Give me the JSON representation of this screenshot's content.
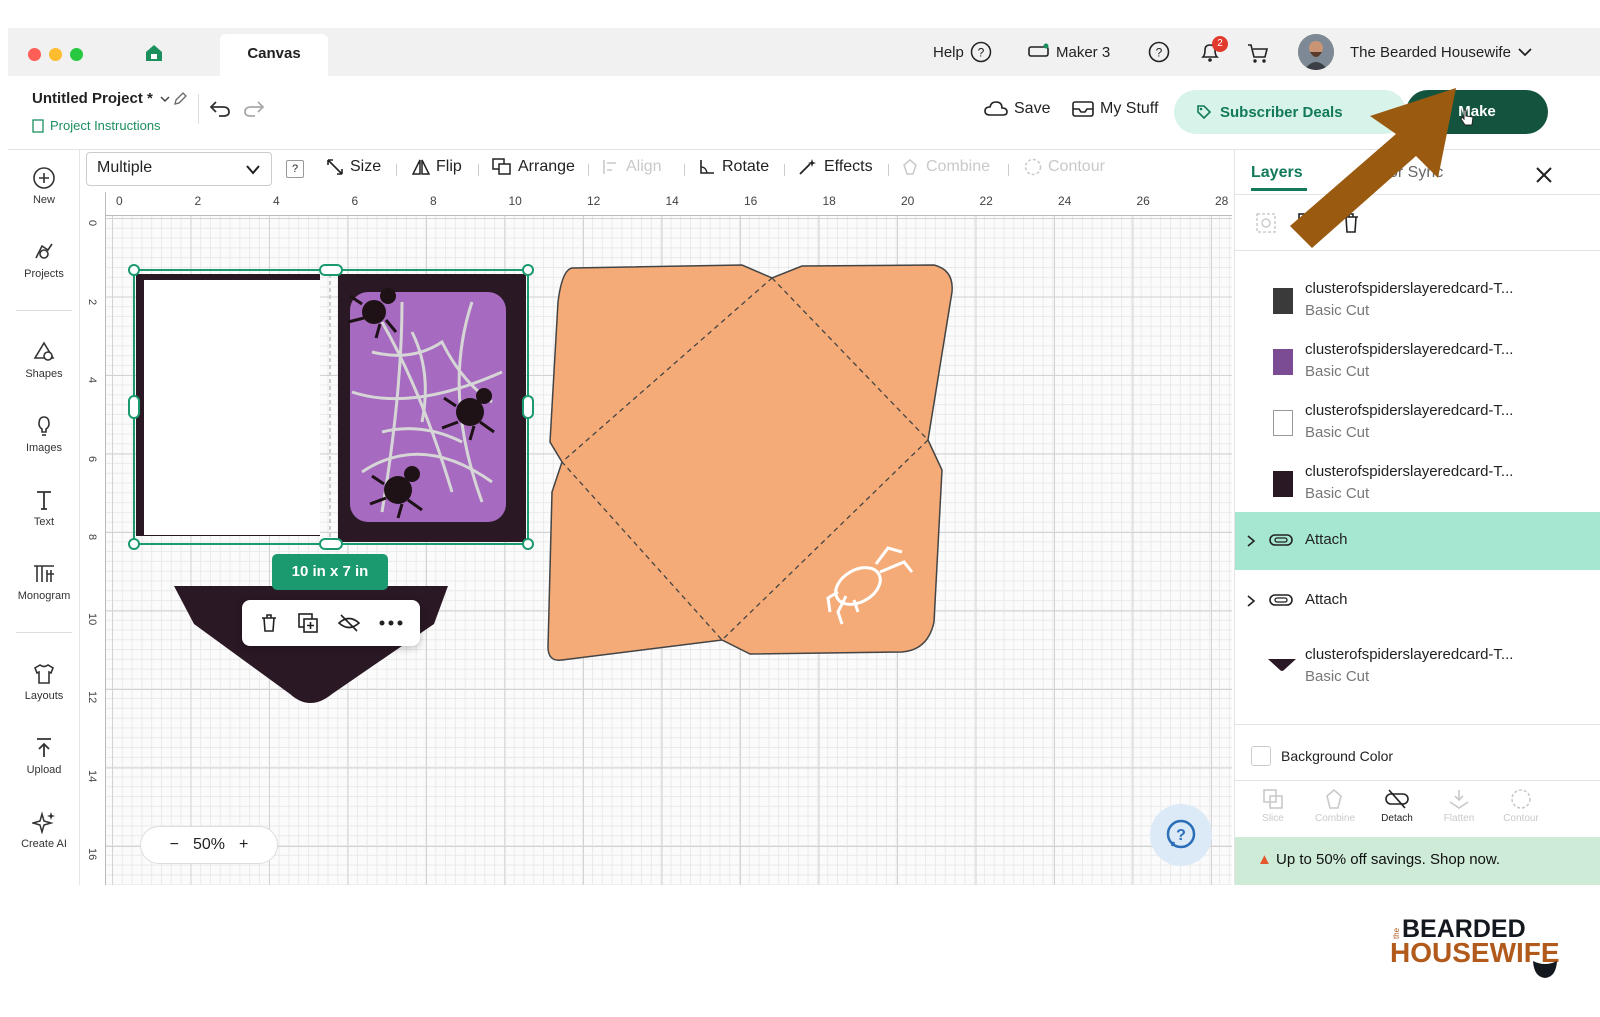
{
  "titlebar": {
    "tab": "Canvas",
    "help": "Help",
    "machine": "Maker 3",
    "notifications_count": "2",
    "user_name": "The Bearded Housewife"
  },
  "header": {
    "project_title": "Untitled Project *",
    "project_instructions": "Project Instructions",
    "save": "Save",
    "my_stuff": "My Stuff",
    "subscriber_deals": "Subscriber Deals",
    "make": "Make"
  },
  "toolbar": {
    "select_value": "Multiple",
    "help_glyph": "?",
    "size": "Size",
    "flip": "Flip",
    "arrange": "Arrange",
    "align": "Align",
    "rotate": "Rotate",
    "effects": "Effects",
    "combine": "Combine",
    "contour": "Contour"
  },
  "sidebar": {
    "items": [
      {
        "label": "New",
        "icon": "plus-circle-icon"
      },
      {
        "label": "Projects",
        "icon": "projects-icon"
      },
      {
        "label": "Shapes",
        "icon": "shapes-icon"
      },
      {
        "label": "Images",
        "icon": "lightbulb-icon"
      },
      {
        "label": "Text",
        "icon": "text-icon"
      },
      {
        "label": "Monogram",
        "icon": "monogram-icon"
      },
      {
        "label": "Layouts",
        "icon": "shirt-icon"
      },
      {
        "label": "Upload",
        "icon": "upload-icon"
      },
      {
        "label": "Create AI",
        "icon": "sparkle-icon"
      }
    ]
  },
  "ruler": {
    "top": [
      "0",
      "2",
      "4",
      "6",
      "8",
      "10",
      "12",
      "14",
      "16",
      "18",
      "20",
      "22",
      "24",
      "26",
      "28"
    ],
    "left": [
      "0",
      "2",
      "4",
      "6",
      "8",
      "10",
      "12",
      "14",
      "16"
    ]
  },
  "canvas": {
    "selection_size": "10 in x 7 in",
    "zoom": "50%",
    "zoom_minus": "−",
    "zoom_plus": "+"
  },
  "panel": {
    "tab_layers": "Layers",
    "tab_other": "Color Sync",
    "layers": [
      {
        "name": "clusterofspiderslayeredcard-T...",
        "op": "Basic Cut",
        "thumb_color": "#3a3a3a"
      },
      {
        "name": "clusterofspiderslayeredcard-T...",
        "op": "Basic Cut",
        "thumb_color": "#7b4b94"
      },
      {
        "name": "clusterofspiderslayeredcard-T...",
        "op": "Basic Cut",
        "thumb_color": "#ffffff"
      },
      {
        "name": "clusterofspiderslayeredcard-T...",
        "op": "Basic Cut",
        "thumb_color": "#2a1824"
      }
    ],
    "attach_1": "Attach",
    "attach_2": "Attach",
    "last_layer": {
      "name": "clusterofspiderslayeredcard-T...",
      "op": "Basic Cut"
    },
    "background_color": "Background Color",
    "bottom_tools": [
      {
        "label": "Slice"
      },
      {
        "label": "Combine"
      },
      {
        "label": "Detach"
      },
      {
        "label": "Flatten"
      },
      {
        "label": "Contour"
      }
    ],
    "promo": "Up to 50% off savings. Shop now."
  },
  "brand": {
    "the": "the",
    "line1": "BEARDED",
    "line2": "HOUSEWIFE"
  },
  "colors": {
    "accent": "#14543f",
    "attach_highlight": "#a6e7d2",
    "envelope": "#f4ab77",
    "card_dark": "#2a1824",
    "card_purple": "#a66bc0",
    "arrow": "#9a5a10"
  }
}
